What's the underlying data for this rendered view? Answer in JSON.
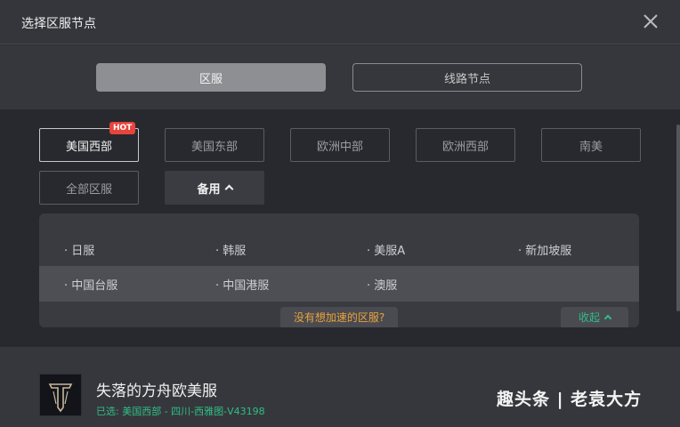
{
  "header": {
    "title": "选择区服节点"
  },
  "tabs": [
    {
      "label": "区服"
    },
    {
      "label": "线路节点"
    }
  ],
  "regions": {
    "hot_badge": "HOT",
    "items": [
      "美国西部",
      "美国东部",
      "欧洲中部",
      "欧洲西部",
      "南美",
      "全部区服",
      "备用"
    ]
  },
  "backup": {
    "row1": [
      "· 日服",
      "· 韩服",
      "· 美服A",
      "· 新加坡服"
    ],
    "row2": [
      "· 中国台服",
      "· 中国港服",
      "· 澳服"
    ],
    "ask_label": "没有想加速的区服?",
    "collapse_label": "收起"
  },
  "game": {
    "name": "失落的方舟欧美服",
    "selected_prefix": "已选: ",
    "selected_value": "美国西部 - 四川-西雅图-V43198"
  },
  "watermark": {
    "text": "趣头条 | 老袁大方"
  },
  "colors": {
    "accent_green": "#2fbf85",
    "warn_orange": "#e8a33a",
    "hot_red": "#e8443c"
  },
  "icons": {
    "close": "close-icon",
    "chevron": "chevron-up-icon"
  }
}
